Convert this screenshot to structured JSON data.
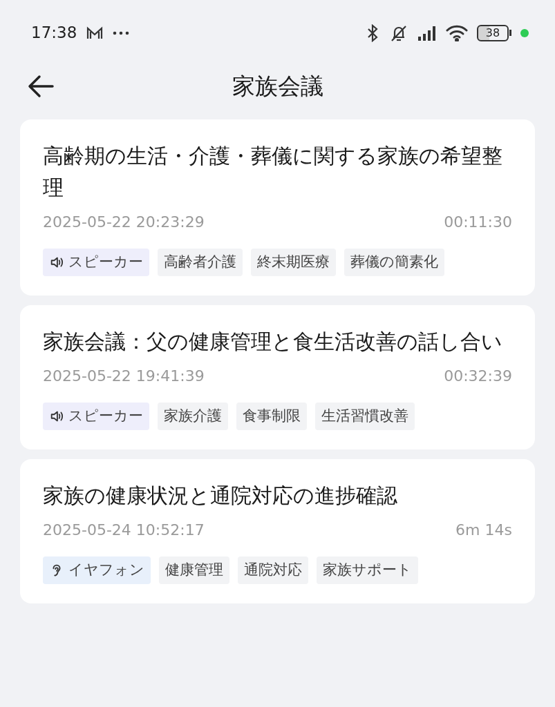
{
  "status_bar": {
    "time": "17:38",
    "battery": "38"
  },
  "header": {
    "title": "家族会議"
  },
  "meetings": [
    {
      "title": "高齢期の生活・介護・葬儀に関する家族の希望整理",
      "datetime": "2025-05-22 20:23:29",
      "duration": "00:11:30",
      "device": {
        "kind": "speaker",
        "label": "スピーカー"
      },
      "tags": [
        "高齢者介護",
        "終末期医療",
        "葬儀の簡素化"
      ]
    },
    {
      "title": "家族会議：父の健康管理と食生活改善の話し合い",
      "datetime": "2025-05-22 19:41:39",
      "duration": "00:32:39",
      "device": {
        "kind": "speaker",
        "label": "スピーカー"
      },
      "tags": [
        "家族介護",
        "食事制限",
        "生活習慣改善"
      ]
    },
    {
      "title": "家族の健康状況と通院対応の進捗確認",
      "datetime": "2025-05-24 10:52:17",
      "duration": "6m 14s",
      "device": {
        "kind": "earphone",
        "label": "イヤフォン"
      },
      "tags": [
        "健康管理",
        "通院対応",
        "家族サポート"
      ]
    }
  ]
}
